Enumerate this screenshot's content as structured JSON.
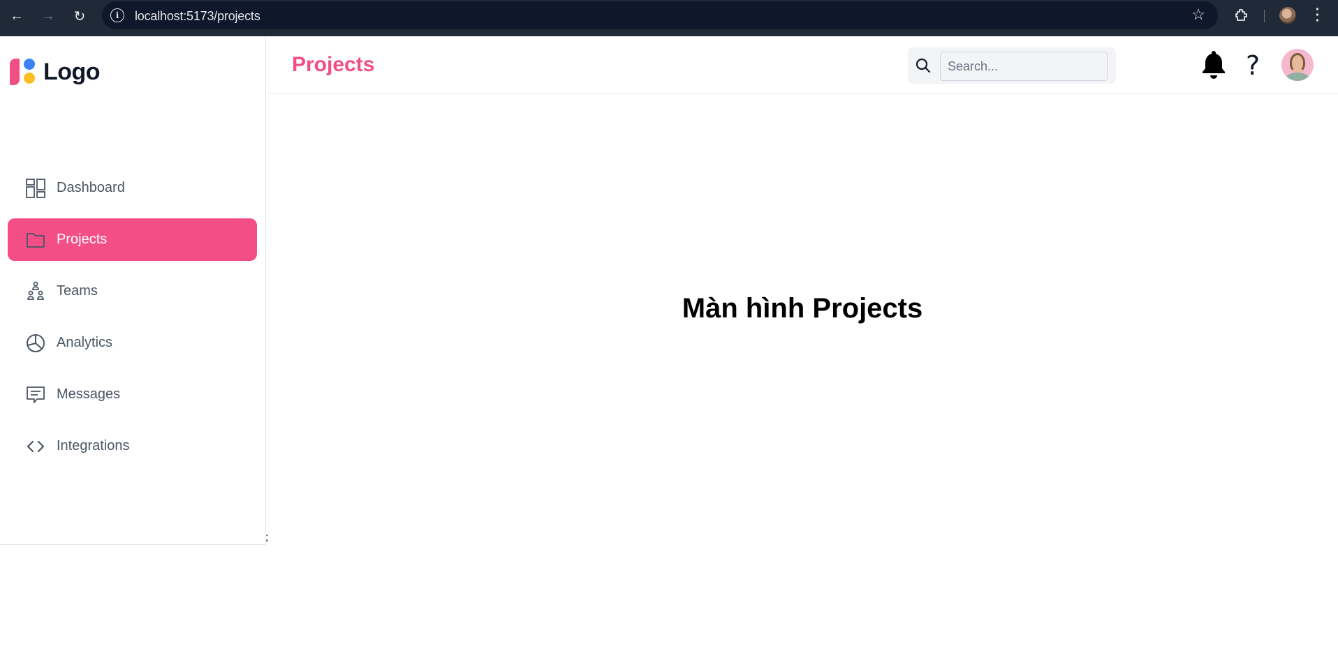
{
  "browser": {
    "url": "localhost:5173/projects"
  },
  "logo": {
    "text": "Logo"
  },
  "sidebar": {
    "items": [
      {
        "label": "Dashboard",
        "icon": "dashboard-icon",
        "active": false
      },
      {
        "label": "Projects",
        "icon": "folder-icon",
        "active": true
      },
      {
        "label": "Teams",
        "icon": "teams-icon",
        "active": false
      },
      {
        "label": "Analytics",
        "icon": "pie-chart-icon",
        "active": false
      },
      {
        "label": "Messages",
        "icon": "message-icon",
        "active": false
      },
      {
        "label": "Integrations",
        "icon": "code-icon",
        "active": false
      }
    ]
  },
  "header": {
    "title": "Projects",
    "search_placeholder": "Search...",
    "help_label": "?"
  },
  "main": {
    "heading": "Màn hình Projects",
    "stray_text": ";"
  },
  "colors": {
    "accent": "#f34f86",
    "chrome": "#1f2937",
    "nav_text": "#4b5563"
  }
}
